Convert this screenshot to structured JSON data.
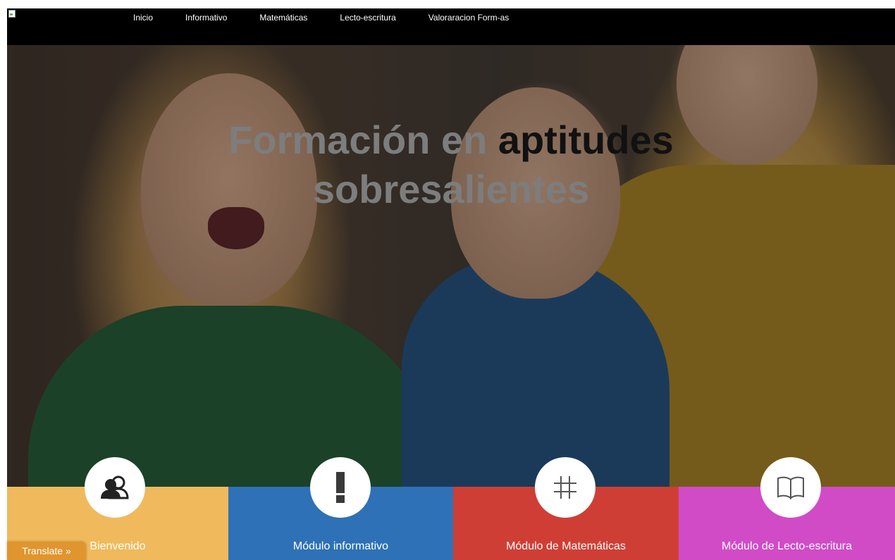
{
  "nav": {
    "logo_icon": "broken-image-icon",
    "items": [
      {
        "label": "Inicio"
      },
      {
        "label": "Informativo"
      },
      {
        "label": "Matemáticas"
      },
      {
        "label": "Lecto-escritura"
      },
      {
        "label": "Valoraracion Form-as"
      }
    ]
  },
  "hero": {
    "title_part1": "Formación en ",
    "title_part2": "aptitudes",
    "title_part3": "sobresalientes",
    "image": "photo of three smiling children in front of bookshelves"
  },
  "tiles": [
    {
      "label": "Bienvenido",
      "icon": "users-icon",
      "color": "#f0b95c"
    },
    {
      "label": "Módulo informativo",
      "icon": "exclamation-icon",
      "color": "#2e71b6"
    },
    {
      "label": "Módulo de Matemáticas",
      "icon": "hash-icon",
      "color": "#cf3e34"
    },
    {
      "label": "Módulo de Lecto-escritura",
      "icon": "book-icon",
      "color": "#d14bc7"
    }
  ],
  "translate": {
    "label": "Translate »",
    "color": "#e0952f"
  }
}
